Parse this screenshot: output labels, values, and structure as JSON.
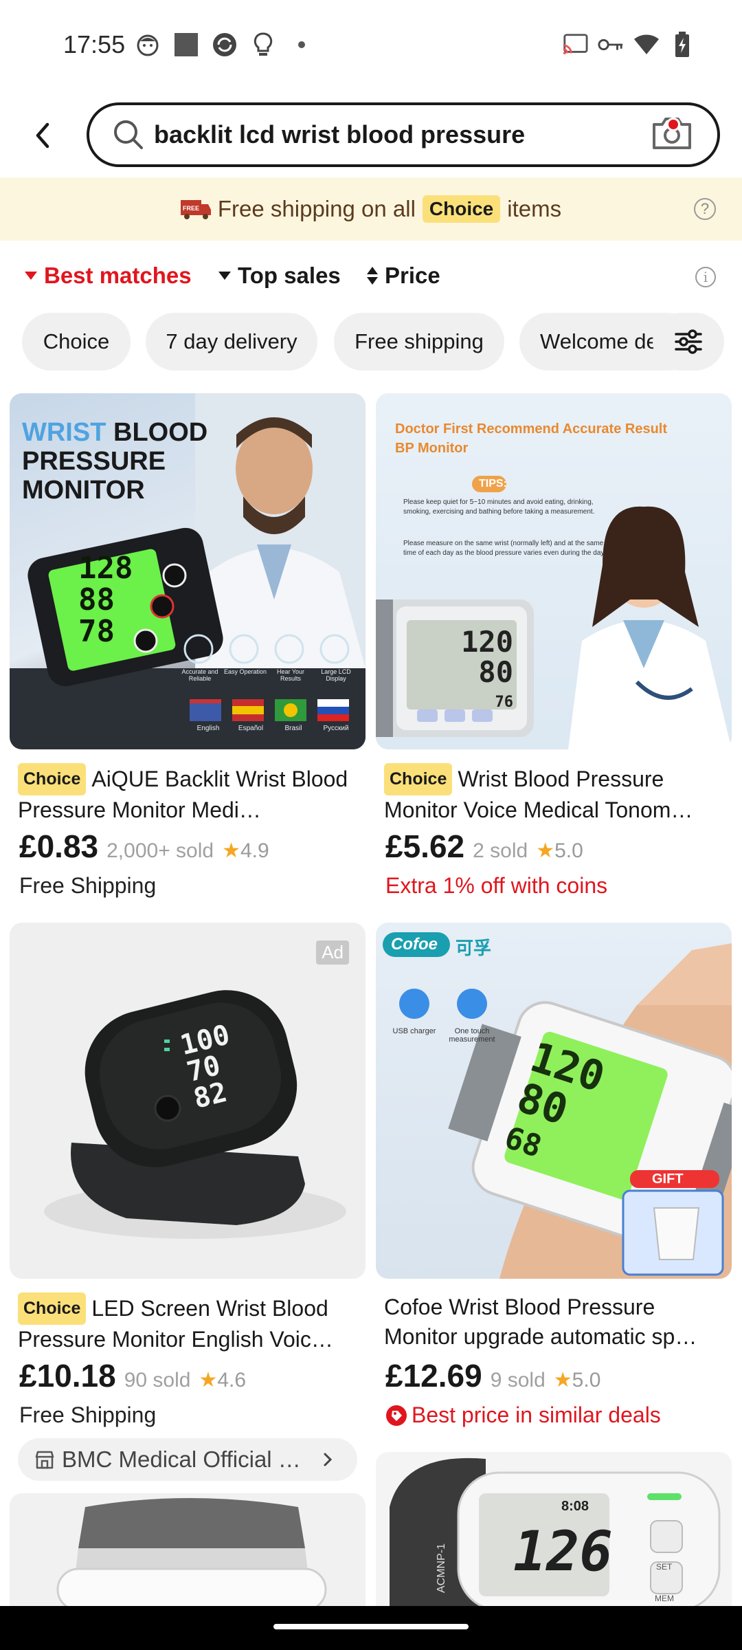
{
  "status_bar": {
    "time": "17:55"
  },
  "search": {
    "query": "backlit lcd wrist blood pressure"
  },
  "promo": {
    "text_before": "Free shipping on all",
    "choice": "Choice",
    "text_after": "items",
    "truck_label": "FREE"
  },
  "sort": {
    "best": "Best matches",
    "top": "Top sales",
    "price": "Price",
    "active": "Best matches"
  },
  "chips": [
    "Choice",
    "7 day delivery",
    "Free shipping",
    "Welcome deals"
  ],
  "products": [
    {
      "choice": "Choice",
      "title": "AiQUE Backlit Wrist Blood Pressure Monitor Medi…",
      "price": "£0.83",
      "sold": "2,000+ sold",
      "rating": "4.9",
      "note": "Free Shipping",
      "image": {
        "headline_1": "WRIST",
        "headline_2": "BLOOD",
        "headline_3": "PRESSURE",
        "headline_4": "MONITOR",
        "readings": [
          "128",
          "88",
          "78"
        ],
        "features": [
          "Accurate and Reliable",
          "Easy Operation",
          "Hear Your Results",
          "Large LCD Display"
        ],
        "languages": [
          "English",
          "Español",
          "Brasil",
          "Русский"
        ]
      }
    },
    {
      "choice": "Choice",
      "title": "Wrist Blood Pressure Monitor Voice Medical Tonom…",
      "price": "£5.62",
      "sold": "2 sold",
      "rating": "5.0",
      "note": "Extra 1% off with coins",
      "image": {
        "headline_1": "Doctor First Recommend Accurate Result",
        "headline_2": "BP Monitor",
        "tips": "TIPS:",
        "tip_1": "Please keep quiet for 5~10 minutes and avoid eating, drinking, smoking, exercising and bathing before taking a measurement.",
        "tip_2": "Please measure on the same wrist (normally left) and at the same time of each day as the blood pressure varies even during the day.",
        "readings": [
          "120",
          "80",
          "76"
        ]
      }
    },
    {
      "choice": "Choice",
      "title": "LED Screen Wrist Blood Pressure Monitor English Voic…",
      "price": "£10.18",
      "sold": "90 sold",
      "rating": "4.6",
      "note": "Free Shipping",
      "store": "BMC Medical Official …",
      "ad": "Ad",
      "image": {
        "readings": [
          "100",
          "70",
          "82"
        ]
      }
    },
    {
      "title": "Cofoe Wrist Blood Pressure Monitor upgrade automatic sp…",
      "price": "£12.69",
      "sold": "9 sold",
      "rating": "5.0",
      "note": "Best price in similar deals",
      "image": {
        "brand": "Cofoe",
        "brand_cn": "可孚",
        "usb": "USB charger",
        "touch": "One touch measurement",
        "gift": "GIFT",
        "readings": [
          "120",
          "80",
          "68"
        ]
      }
    },
    {
      "image": {}
    },
    {
      "image": {
        "readings": [
          "126"
        ],
        "time": "8:08",
        "model": "ACMNP-1",
        "set": "SET",
        "mem": "MEM"
      }
    }
  ]
}
